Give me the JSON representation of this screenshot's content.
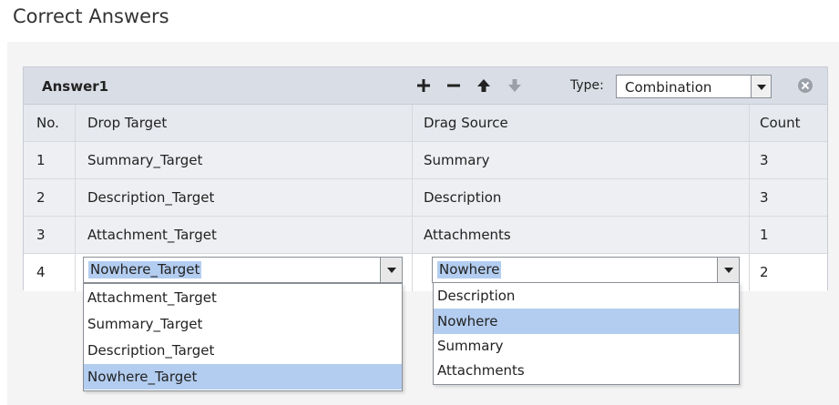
{
  "page": {
    "title": "Correct Answers"
  },
  "panel": {
    "title": "Answer1",
    "type_label": "Type:",
    "type_value": "Combination"
  },
  "columns": {
    "no": "No.",
    "drop_target": "Drop Target",
    "drag_source": "Drag Source",
    "count": "Count"
  },
  "rows": [
    {
      "no": "1",
      "drop_target": "Summary_Target",
      "drag_source": "Summary",
      "count": "3"
    },
    {
      "no": "2",
      "drop_target": "Description_Target",
      "drag_source": "Description",
      "count": "3"
    },
    {
      "no": "3",
      "drop_target": "Attachment_Target",
      "drag_source": "Attachments",
      "count": "1"
    }
  ],
  "edit_row": {
    "no": "4",
    "drop_target_value": "Nowhere_Target",
    "drag_source_value": "Nowhere",
    "count": "2"
  },
  "drop_target_options": [
    "Attachment_Target",
    "Summary_Target",
    "Description_Target",
    "Nowhere_Target"
  ],
  "drag_source_options": [
    "Description",
    "Nowhere",
    "Summary",
    "Attachments"
  ],
  "icons": {
    "add": "plus-icon",
    "remove": "minus-icon",
    "move_up": "arrow-up-icon",
    "move_down": "arrow-down-icon",
    "close": "close-circle-icon"
  },
  "colors": {
    "header_bg": "#d9dee6",
    "selection": "#b3cdf0",
    "disabled_icon": "#9aa0a8"
  }
}
